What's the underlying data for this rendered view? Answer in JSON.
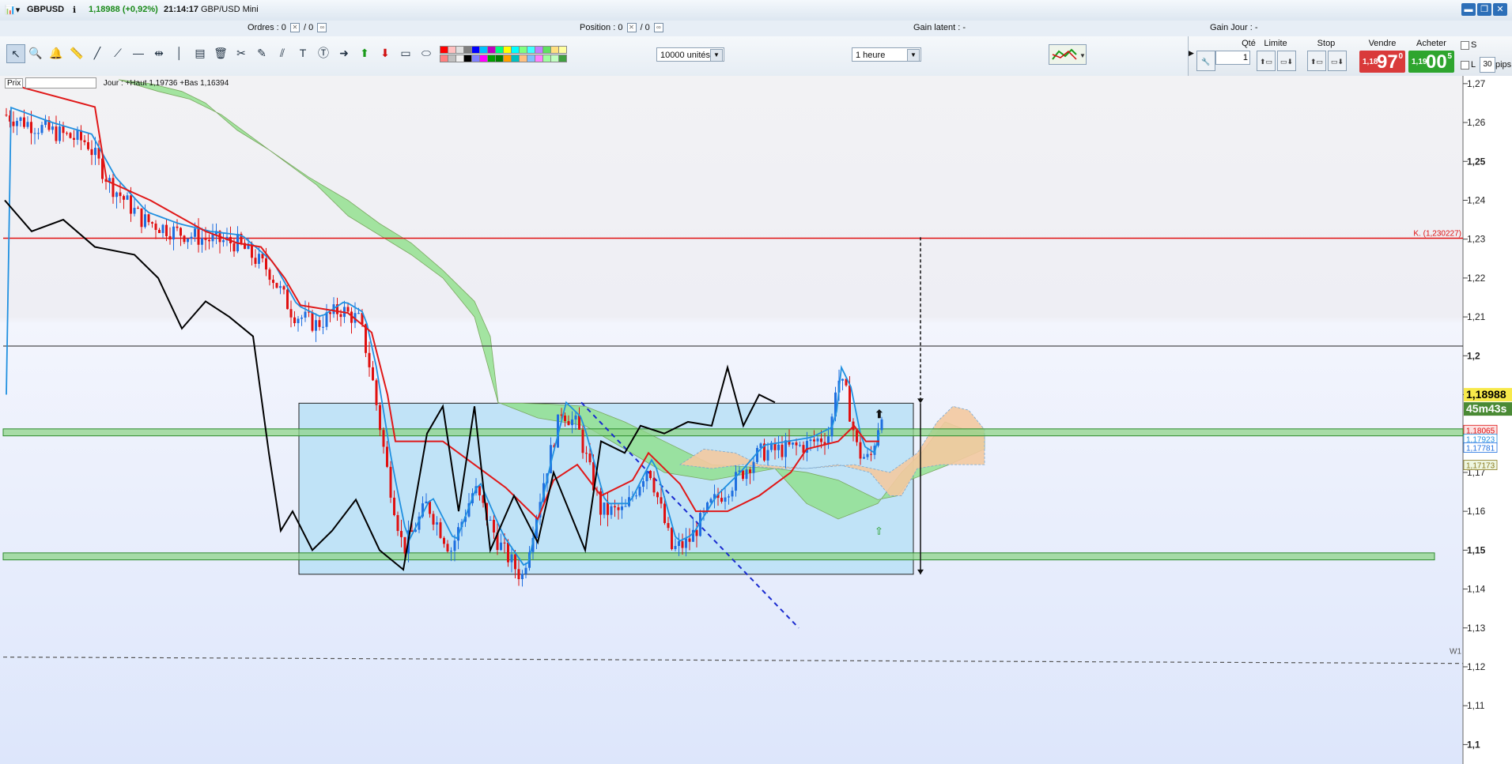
{
  "app": {
    "symbol": "GBPUSD",
    "price": "1,18988 (+0,92%)",
    "time": "21:14:17",
    "instrument": "GBP/USD Mini",
    "window_controls": [
      "▬",
      "❐",
      "✕"
    ]
  },
  "infobar": {
    "orders_label": "Ordres :",
    "orders_value1": "0",
    "orders_value2": "/ 0",
    "position_label": "Position :",
    "position_value1": "0",
    "position_value2": "/ 0",
    "gain_latent_label": "Gain latent :",
    "gain_latent_value": "-",
    "gain_jour_label": "Gain Jour :",
    "gain_jour_value": "-"
  },
  "toolbar": {
    "tools": [
      "pointer-icon",
      "zoom-icon",
      "alert-icon",
      "ruler-icon",
      "line-icon",
      "ray-icon",
      "horizontal-line-icon",
      "horizontal-segment-icon",
      "vertical-line-icon",
      "fib-icon",
      "trash-icon",
      "tools-icon",
      "pen-icon",
      "channel-icon",
      "text-icon",
      "text-circle-icon",
      "arrow-right-icon",
      "arrow-up-icon",
      "arrow-down-icon",
      "rectangle-icon",
      "ellipse-icon"
    ],
    "units_select": "10000 unités",
    "timeframe_select": "1 heure",
    "swatch_colors": [
      "#ff0000",
      "#ff8080",
      "#ffc0c0",
      "#c0c0c0",
      "#e0e0e0",
      "#f0f0f0",
      "#808080",
      "#000000",
      "#0000ff",
      "#8080ff",
      "#00c0ff",
      "#ff00ff",
      "#c000c0",
      "#00a000",
      "#00ff80",
      "#008000",
      "#ffff00",
      "#ffa000",
      "#00ffff",
      "#00c0c0",
      "#80ff80",
      "#ffc080",
      "#40ffff",
      "#80c0ff",
      "#c080ff",
      "#ff80ff",
      "#60e060",
      "#a0ffa0",
      "#ffe080",
      "#c0ffc0",
      "#ffffa0",
      "#40a040"
    ]
  },
  "order_panel": {
    "qty_label": "Qté",
    "qty_value": "1",
    "limit_label": "Limite",
    "stop_label": "Stop",
    "sell_label": "Vendre",
    "buy_label": "Acheter",
    "sell_small": "1,18",
    "sell_large": "97",
    "sell_sup": "0",
    "buy_small": "1,19",
    "buy_large": "00",
    "buy_sup": "5",
    "s_label": "S",
    "l_label": "L",
    "pips_value": "30",
    "pips_label": "pips"
  },
  "chart": {
    "header_prix": "Prix",
    "header_text": "Jour : +Haut 1,19736 +Bas 1,16394",
    "k_label": "K. (1,230227)",
    "w1_label": "W1",
    "last_price": "1,18988",
    "countdown": "45m43s",
    "side_labels": [
      "1,18065",
      "1,17923",
      "1,17781",
      "1,17173"
    ],
    "colors": {
      "bull": "#1f6fe0",
      "bear": "#e01010",
      "kijun": "#e01818",
      "tenkan": "#2090e0",
      "chikou": "#000000",
      "cloud_bull": "#8fe08a",
      "cloud_bear": "#f3c9a0",
      "range_box": "#b8e0f6"
    }
  },
  "chart_data": {
    "type": "candlestick",
    "yaxis_ticks": [
      "1,27",
      "1,26",
      "1,25",
      "1,24",
      "1,23",
      "1,22",
      "1,21",
      "1,2",
      "1,19",
      "1,18",
      "1,17",
      "1,16",
      "1,15",
      "1,14",
      "1,13",
      "1,12",
      "1,11",
      "1,1"
    ],
    "ylim": [
      1.095,
      1.272
    ],
    "horizontal_levels": [
      1.230227,
      1.2025,
      1.1505,
      1.1225
    ],
    "support_zones": [
      [
        1.1794,
        1.1812
      ],
      [
        1.1475,
        1.1493
      ]
    ],
    "range_box": {
      "low": 1.1438,
      "high": 1.1878
    },
    "grid": false
  }
}
